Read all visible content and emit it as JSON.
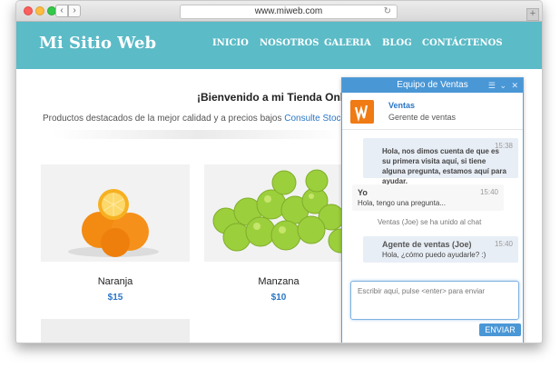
{
  "browser": {
    "url": "www.miweb.com"
  },
  "site": {
    "logo": "Mi Sitio Web",
    "nav": [
      "INICIO",
      "NOSOTROS",
      "GALERIA",
      "BLOG",
      "CONTÁCTENOS"
    ],
    "welcome": "¡Bienvenido a mi Tienda Online!",
    "subtitle_text": "Productos destacados de la mejor calidad y a precios bajos",
    "subtitle_link": "Consulte Stock → $",
    "products": [
      {
        "name": "Naranja",
        "price": "$15"
      },
      {
        "name": "Manzana",
        "price": "$10"
      }
    ]
  },
  "chat": {
    "title": "Equipo de Ventas",
    "agent_name": "Ventas",
    "agent_role": "Gerente de ventas",
    "messages": [
      {
        "time": "15:38",
        "text": "Hola, nos dimos cuenta de que es su primera visita aquí, si tiene alguna pregunta, estamos aquí para ayudar."
      },
      {
        "sender": "Yo",
        "time": "15:40",
        "text": "Hola, tengo una pregunta..."
      },
      {
        "sender": "Agente de ventas (Joe)",
        "time": "15:40",
        "text": "Hola, ¿cómo puedo ayudarle? :)"
      }
    ],
    "system": "Ventas (Joe) se ha unido al chat",
    "input_placeholder": "Escribir aquí, pulse <enter> para enviar",
    "send_label": "ENVIAR"
  }
}
